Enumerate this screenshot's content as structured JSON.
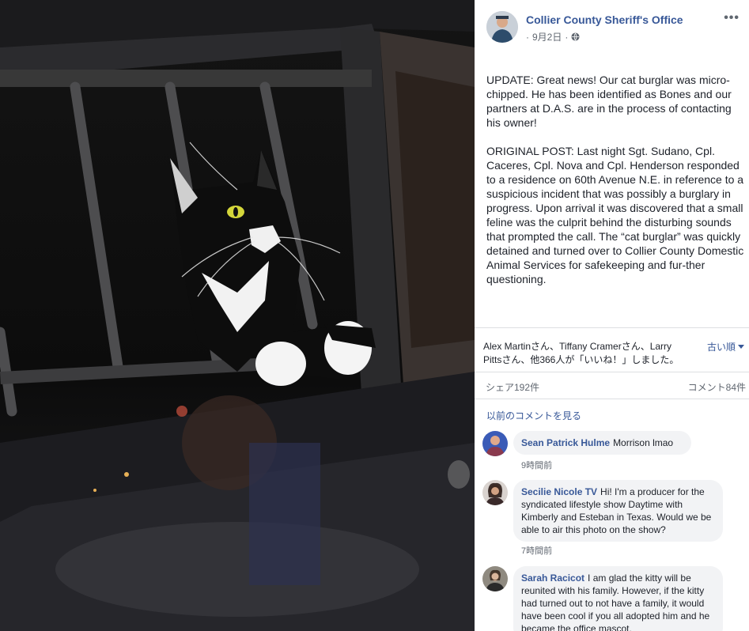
{
  "photo": {
    "icon": "cat-in-police-car-photo",
    "colors": {
      "fur": "#0d0d0d",
      "white_fur": "#f2f2f2",
      "bars": "#4a4a4a",
      "eye": "#d4d63a"
    }
  },
  "post": {
    "page_name": "Collier County Sheriff's Office",
    "date": "9月2日",
    "privacy_icon": "globe-icon",
    "more_icon": "more-options-icon",
    "paragraphs": [
      "UPDATE: Great news! Our cat burglar was micro-chipped. He has been identified as Bones and our partners at D.A.S. are in the process of contacting his owner!",
      "ORIGINAL POST: Last night Sgt. Sudano, Cpl. Caceres, Cpl. Nova and Cpl. Henderson responded to a residence on 60th Avenue N.E. in reference to a suspicious incident that was possibly a burglary in progress. Upon arrival it was discovered that a small feline was the culprit behind the disturbing sounds that prompted the call. The “cat burglar” was quickly detained and turned over to Collier County Domestic Animal Services for safekeeping and fur-ther questioning."
    ]
  },
  "engagement": {
    "reactions": "Alex Martinさん、Tiffany Cramerさん、Larry Pittsさん、他366人が「いいね！」しました。",
    "sort": "古い順",
    "shares": "シェア192件",
    "comments": "コメント84件",
    "view_previous": "以前のコメントを見る"
  },
  "comments": [
    {
      "author": "Sean Patrick Hulme",
      "text": "Morrison lmao",
      "time": "9時間前"
    },
    {
      "author": "Secilie Nicole TV",
      "text": "Hi! I'm a producer for the syndicated lifestyle show Daytime with Kimberly and Esteban in Texas. Would we be able to air this photo on the show?",
      "time": "7時間前"
    },
    {
      "author": "Sarah Racicot",
      "text": "I am glad the kitty will be reunited with his family. However, if the kitty had turned out to not have a family, it would have been cool if you all adopted him and he became the office mascot.",
      "time": ""
    }
  ],
  "colors": {
    "link": "#385898",
    "meta": "#606770",
    "bubble": "#f2f3f5",
    "text": "#1d2129"
  }
}
